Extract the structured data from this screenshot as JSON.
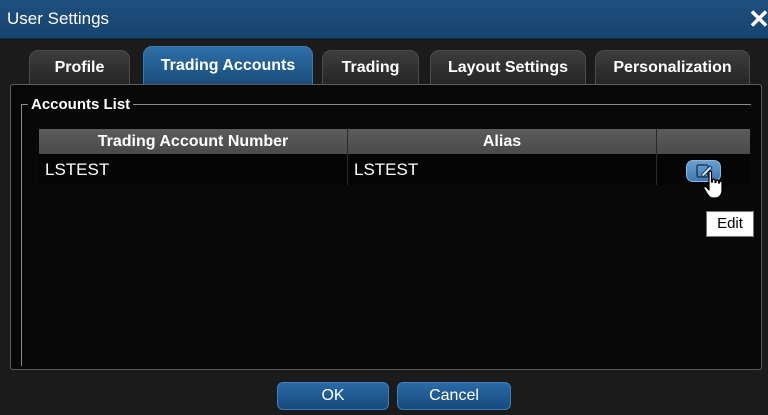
{
  "window": {
    "title": "User Settings",
    "close_glyph": "✕"
  },
  "tabs": [
    {
      "label": "Profile",
      "active": false
    },
    {
      "label": "Trading Accounts",
      "active": true
    },
    {
      "label": "Trading",
      "active": false
    },
    {
      "label": "Layout Settings",
      "active": false
    },
    {
      "label": "Personalization",
      "active": false
    }
  ],
  "accounts": {
    "group_label": "Accounts List",
    "columns": [
      "Trading Account Number",
      "Alias",
      ""
    ],
    "rows": [
      {
        "account_number": "LSTEST",
        "alias": "LSTEST",
        "action_icon": "edit-icon"
      }
    ]
  },
  "tooltip": {
    "text": "Edit"
  },
  "footer": {
    "ok_label": "OK",
    "cancel_label": "Cancel"
  },
  "colors": {
    "title_bar": "#1f4f7e",
    "active_tab": "#2e6fa6",
    "button": "#2a6aa5",
    "edit_button": "#5a90c6"
  }
}
